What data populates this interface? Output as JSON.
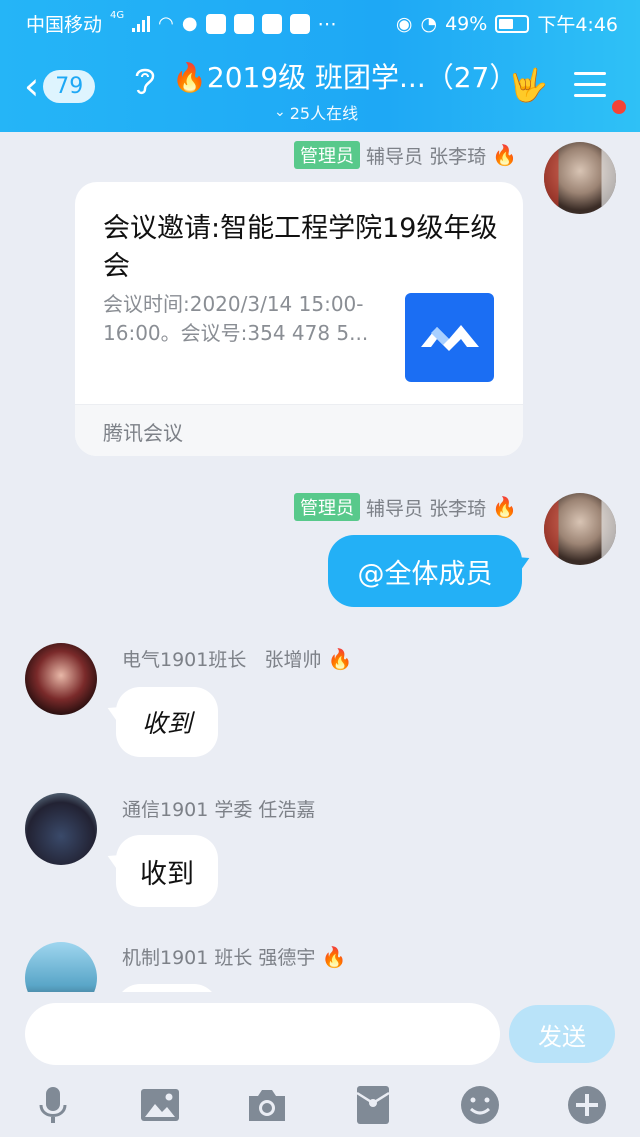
{
  "status_bar": {
    "carrier": "中国移动",
    "network": "4G",
    "battery": "49%",
    "time": "下午4:46"
  },
  "header": {
    "back_count": "79",
    "title": "2019级 班团学...（27）",
    "online": "25人在线"
  },
  "messages": [
    {
      "admin_tag": "管理员",
      "sender": "辅导员 张李琦",
      "card": {
        "title": "会议邀请:智能工程学院19级年级会",
        "description": "会议时间:2020/3/14 15:00-16:00。会议号:354 478 5...",
        "source": "腾讯会议"
      }
    },
    {
      "admin_tag": "管理员",
      "sender": "辅导员 张李琦",
      "text": "@全体成员"
    },
    {
      "sender": "电气1901班长   张增帅",
      "text": "收到"
    },
    {
      "sender": "通信1901 学委 任浩嘉",
      "text": "收到"
    },
    {
      "sender": "机制1901 班长 强德宇",
      "text": ""
    }
  ],
  "input": {
    "value": "",
    "send_label": "发送"
  },
  "colors": {
    "accent": "#1ea8f5",
    "admin_tag": "#58c98b",
    "outgoing_bubble": "#23b0f6"
  }
}
